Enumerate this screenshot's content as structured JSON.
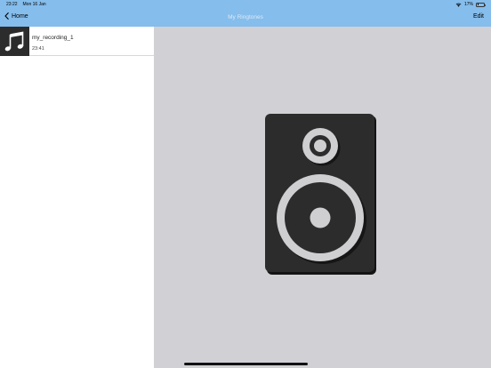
{
  "status_bar": {
    "time": "23:22",
    "date": "Mon 16 Jan",
    "battery": "17%",
    "battery_level": 0.17
  },
  "nav": {
    "back_label": "Home",
    "title": "My Ringtones",
    "edit_label": "Edit"
  },
  "recordings": [
    {
      "title": "my_recording_1",
      "subtitle": "23:41",
      "icon": "music-note-icon"
    }
  ],
  "detail": {
    "icon": "speaker-icon"
  },
  "colors": {
    "nav_background": "#85bdec",
    "detail_background": "#d1d0d5",
    "speaker_body": "#2c2c2c",
    "speaker_cone": "#cfcfd2"
  }
}
